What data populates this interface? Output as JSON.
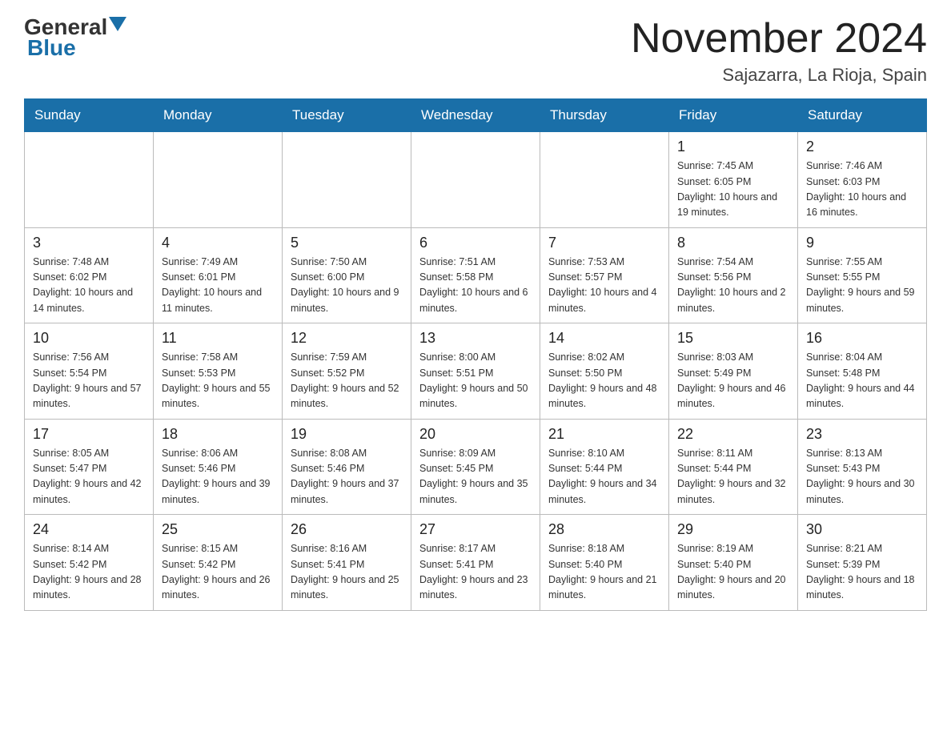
{
  "header": {
    "logo": {
      "general": "General",
      "blue": "Blue"
    },
    "title": "November 2024",
    "location": "Sajazarra, La Rioja, Spain"
  },
  "days_of_week": [
    "Sunday",
    "Monday",
    "Tuesday",
    "Wednesday",
    "Thursday",
    "Friday",
    "Saturday"
  ],
  "weeks": [
    [
      {
        "day": "",
        "info": ""
      },
      {
        "day": "",
        "info": ""
      },
      {
        "day": "",
        "info": ""
      },
      {
        "day": "",
        "info": ""
      },
      {
        "day": "",
        "info": ""
      },
      {
        "day": "1",
        "info": "Sunrise: 7:45 AM\nSunset: 6:05 PM\nDaylight: 10 hours and 19 minutes."
      },
      {
        "day": "2",
        "info": "Sunrise: 7:46 AM\nSunset: 6:03 PM\nDaylight: 10 hours and 16 minutes."
      }
    ],
    [
      {
        "day": "3",
        "info": "Sunrise: 7:48 AM\nSunset: 6:02 PM\nDaylight: 10 hours and 14 minutes."
      },
      {
        "day": "4",
        "info": "Sunrise: 7:49 AM\nSunset: 6:01 PM\nDaylight: 10 hours and 11 minutes."
      },
      {
        "day": "5",
        "info": "Sunrise: 7:50 AM\nSunset: 6:00 PM\nDaylight: 10 hours and 9 minutes."
      },
      {
        "day": "6",
        "info": "Sunrise: 7:51 AM\nSunset: 5:58 PM\nDaylight: 10 hours and 6 minutes."
      },
      {
        "day": "7",
        "info": "Sunrise: 7:53 AM\nSunset: 5:57 PM\nDaylight: 10 hours and 4 minutes."
      },
      {
        "day": "8",
        "info": "Sunrise: 7:54 AM\nSunset: 5:56 PM\nDaylight: 10 hours and 2 minutes."
      },
      {
        "day": "9",
        "info": "Sunrise: 7:55 AM\nSunset: 5:55 PM\nDaylight: 9 hours and 59 minutes."
      }
    ],
    [
      {
        "day": "10",
        "info": "Sunrise: 7:56 AM\nSunset: 5:54 PM\nDaylight: 9 hours and 57 minutes."
      },
      {
        "day": "11",
        "info": "Sunrise: 7:58 AM\nSunset: 5:53 PM\nDaylight: 9 hours and 55 minutes."
      },
      {
        "day": "12",
        "info": "Sunrise: 7:59 AM\nSunset: 5:52 PM\nDaylight: 9 hours and 52 minutes."
      },
      {
        "day": "13",
        "info": "Sunrise: 8:00 AM\nSunset: 5:51 PM\nDaylight: 9 hours and 50 minutes."
      },
      {
        "day": "14",
        "info": "Sunrise: 8:02 AM\nSunset: 5:50 PM\nDaylight: 9 hours and 48 minutes."
      },
      {
        "day": "15",
        "info": "Sunrise: 8:03 AM\nSunset: 5:49 PM\nDaylight: 9 hours and 46 minutes."
      },
      {
        "day": "16",
        "info": "Sunrise: 8:04 AM\nSunset: 5:48 PM\nDaylight: 9 hours and 44 minutes."
      }
    ],
    [
      {
        "day": "17",
        "info": "Sunrise: 8:05 AM\nSunset: 5:47 PM\nDaylight: 9 hours and 42 minutes."
      },
      {
        "day": "18",
        "info": "Sunrise: 8:06 AM\nSunset: 5:46 PM\nDaylight: 9 hours and 39 minutes."
      },
      {
        "day": "19",
        "info": "Sunrise: 8:08 AM\nSunset: 5:46 PM\nDaylight: 9 hours and 37 minutes."
      },
      {
        "day": "20",
        "info": "Sunrise: 8:09 AM\nSunset: 5:45 PM\nDaylight: 9 hours and 35 minutes."
      },
      {
        "day": "21",
        "info": "Sunrise: 8:10 AM\nSunset: 5:44 PM\nDaylight: 9 hours and 34 minutes."
      },
      {
        "day": "22",
        "info": "Sunrise: 8:11 AM\nSunset: 5:44 PM\nDaylight: 9 hours and 32 minutes."
      },
      {
        "day": "23",
        "info": "Sunrise: 8:13 AM\nSunset: 5:43 PM\nDaylight: 9 hours and 30 minutes."
      }
    ],
    [
      {
        "day": "24",
        "info": "Sunrise: 8:14 AM\nSunset: 5:42 PM\nDaylight: 9 hours and 28 minutes."
      },
      {
        "day": "25",
        "info": "Sunrise: 8:15 AM\nSunset: 5:42 PM\nDaylight: 9 hours and 26 minutes."
      },
      {
        "day": "26",
        "info": "Sunrise: 8:16 AM\nSunset: 5:41 PM\nDaylight: 9 hours and 25 minutes."
      },
      {
        "day": "27",
        "info": "Sunrise: 8:17 AM\nSunset: 5:41 PM\nDaylight: 9 hours and 23 minutes."
      },
      {
        "day": "28",
        "info": "Sunrise: 8:18 AM\nSunset: 5:40 PM\nDaylight: 9 hours and 21 minutes."
      },
      {
        "day": "29",
        "info": "Sunrise: 8:19 AM\nSunset: 5:40 PM\nDaylight: 9 hours and 20 minutes."
      },
      {
        "day": "30",
        "info": "Sunrise: 8:21 AM\nSunset: 5:39 PM\nDaylight: 9 hours and 18 minutes."
      }
    ]
  ]
}
